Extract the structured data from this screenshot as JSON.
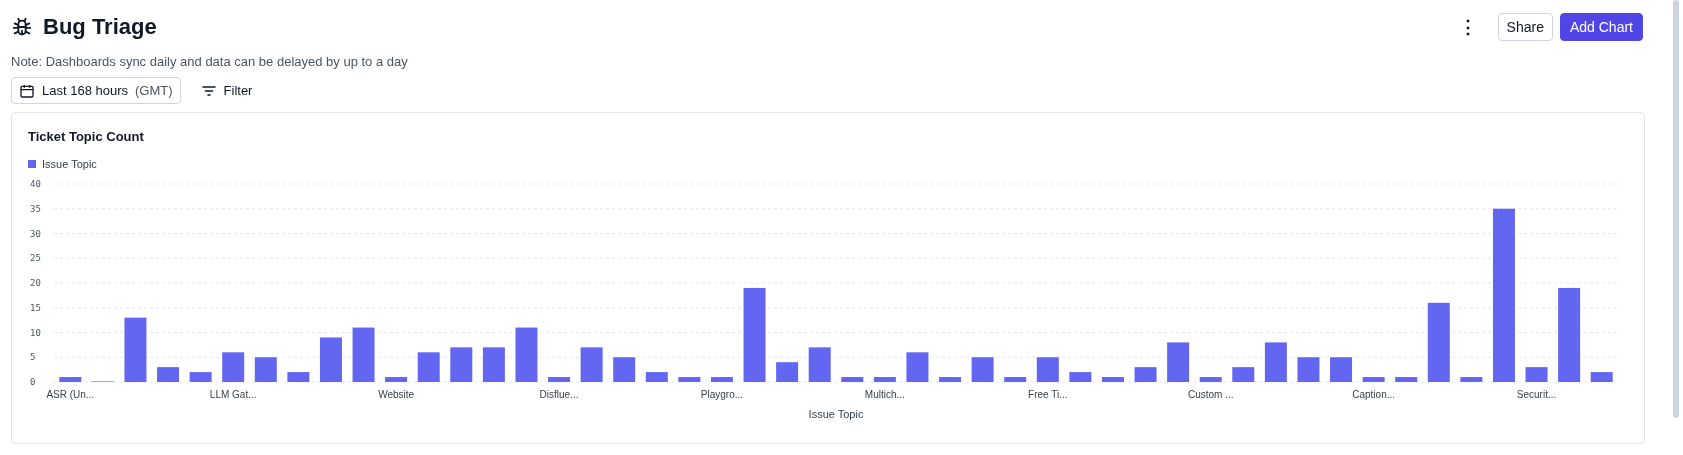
{
  "header": {
    "title": "Bug Triage",
    "note": "Note: Dashboards sync daily and data can be delayed by up to a day",
    "actions": [
      {
        "kind": "menu",
        "label": "⋮"
      },
      {
        "kind": "secondary",
        "label": "Share"
      },
      {
        "kind": "primary",
        "label": "Add Chart"
      }
    ]
  },
  "toolbar": {
    "date_range": {
      "label": "Last 168 hours",
      "zone": "(GMT)"
    },
    "filter": {
      "label": "Filter"
    }
  },
  "chart": {
    "title": "Ticket Topic Count",
    "chart_data": {
      "type": "bar",
      "xlabel": "Issue Topic",
      "series": [
        {
          "name": "Issue Topic",
          "color": "#6366f1",
          "values": [
            1,
            0,
            13,
            3,
            2,
            6,
            5,
            2,
            9,
            11,
            1,
            6,
            7,
            7,
            11,
            1,
            7,
            5,
            2,
            1,
            1,
            19,
            4,
            7,
            1,
            1,
            6,
            1,
            5,
            1,
            5,
            2,
            1,
            3,
            8,
            1,
            3,
            8,
            5,
            5,
            1,
            1,
            16,
            1,
            35,
            3,
            19,
            2
          ]
        }
      ],
      "ylim": [
        0,
        40
      ],
      "yticks": [
        0,
        5,
        10,
        15,
        20,
        25,
        30,
        35,
        40
      ],
      "grid": true,
      "categories": [
        "ASR (Un...",
        null,
        null,
        null,
        null,
        "LLM Gat...",
        null,
        null,
        null,
        null,
        "Website",
        null,
        null,
        null,
        null,
        "Disflue...",
        null,
        null,
        null,
        null,
        "Playgro...",
        null,
        null,
        null,
        null,
        "Multich...",
        null,
        null,
        null,
        null,
        "Free Ti...",
        null,
        null,
        null,
        null,
        "Custom ...",
        null,
        null,
        null,
        null,
        "Caption...",
        null,
        null,
        null,
        null,
        "Securit...",
        null,
        null
      ]
    }
  }
}
